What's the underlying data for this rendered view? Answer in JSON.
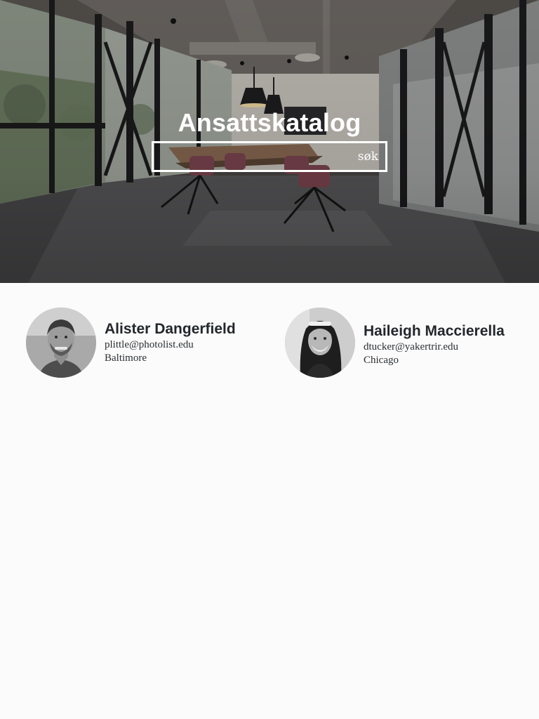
{
  "header": {
    "title": "Ansattskatalog",
    "search": {
      "placeholder": "søk",
      "value": ""
    }
  },
  "employees": [
    {
      "name": "Alister Dangerfield",
      "email": "plittle@photolist.edu",
      "city": "Baltimore"
    },
    {
      "name": "Haileigh Maccierella",
      "email": "dtucker@yakertrir.edu",
      "city": "Chicago"
    }
  ],
  "colors": {
    "page_background": "#fbfbfb",
    "title_text": "#ffffff",
    "name_text": "#23272b"
  },
  "icons": [
    "hero-office-photo",
    "avatar-photo"
  ]
}
